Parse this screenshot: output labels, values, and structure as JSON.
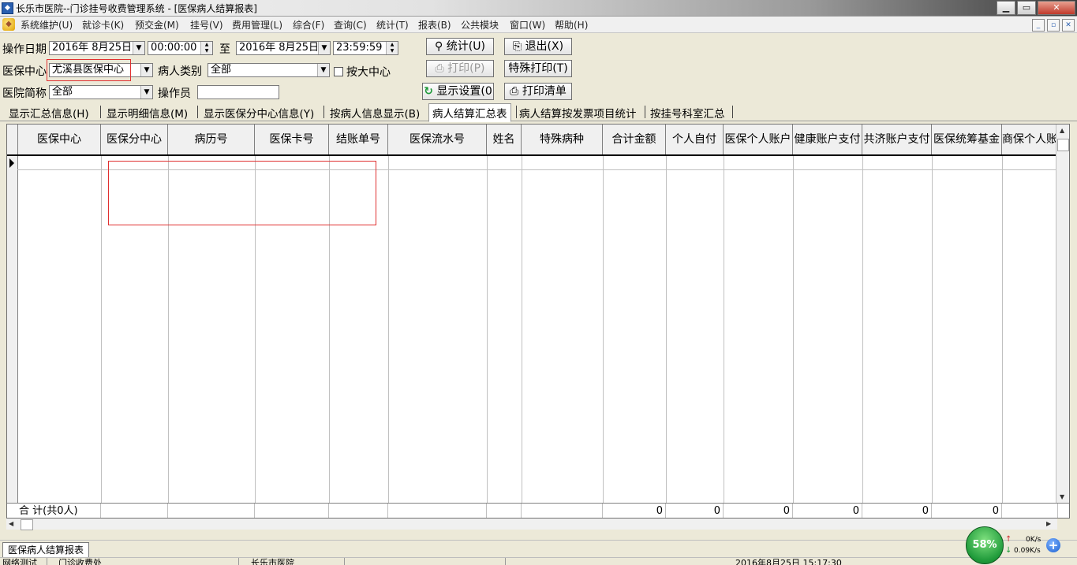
{
  "window": {
    "title": "长乐市医院--门诊挂号收费管理系统 - [医保病人结算报表]",
    "controls": {
      "minimize": "▁",
      "maximize": "▭",
      "close": "✕"
    }
  },
  "menubar": {
    "items": [
      "系统维护(U)",
      "就诊卡(K)",
      "预交金(M)",
      "挂号(V)",
      "费用管理(L)",
      "综合(F)",
      "查询(C)",
      "统计(T)",
      "报表(B)",
      "公共模块",
      "窗口(W)",
      "帮助(H)"
    ],
    "mdi_controls": {
      "minimize": "_",
      "restore": "▫",
      "close": "✕"
    }
  },
  "toolbar": {
    "op_date_label": "操作日期",
    "start_date": "2016年 8月25日",
    "start_time": "00:00:00",
    "to_label": "至",
    "end_date": "2016年 8月25日",
    "end_time": "23:59:59",
    "insurance_center_label": "医保中心",
    "insurance_center_value": "尤溪县医保中心",
    "patient_type_label": "病人类别",
    "patient_type_value": "全部",
    "by_major_center_label": "按大中心",
    "hospital_abbr_label": "医院简称",
    "hospital_abbr_value": "全部",
    "operator_label": "操作员",
    "operator_value": "",
    "buttons": {
      "stats": "统计(U)",
      "exit": "退出(X)",
      "print": "打印(P)",
      "special_print": "特殊打印(T)",
      "display_settings": "显示设置(0",
      "print_list": "打印清单"
    }
  },
  "tabs": [
    {
      "label": "显示汇总信息(H)",
      "active": false
    },
    {
      "label": "显示明细信息(M)",
      "active": false
    },
    {
      "label": "显示医保分中心信息(Y)",
      "active": false
    },
    {
      "label": "按病人信息显示(B)",
      "active": false
    },
    {
      "label": "病人结算汇总表",
      "active": true
    },
    {
      "label": "病人结算按发票项目统计",
      "active": false
    },
    {
      "label": "按挂号科室汇总",
      "active": false
    }
  ],
  "grid": {
    "columns": [
      "医保中心",
      "医保分中心",
      "病历号",
      "医保卡号",
      "结账单号",
      "医保流水号",
      "姓名",
      "特殊病种",
      "合计金额",
      "个人自付",
      "医保个人账户",
      "健康账户支付",
      "共济账户支付",
      "医保统筹基金",
      "商保个人账"
    ],
    "rows": [],
    "total_label": "合 计(共0人)",
    "totals": {
      "合计金额": "0",
      "个人自付": "0",
      "医保个人账户": "0",
      "健康账户支付": "0",
      "共济账户支付": "0",
      "医保统筹基金": "0"
    }
  },
  "bottom_tab": "医保病人结算报表",
  "statusbar": {
    "panels": [
      "网络测试",
      "门诊收费处",
      "长乐市医院",
      "2016年8月25日 15:17:30"
    ]
  },
  "system_tray": {
    "meter_percent": "58%",
    "up_speed": "0K/s",
    "down_speed": "0.09K/s"
  },
  "colors": {
    "highlight_border": "#e03030",
    "meter_green": "#1f9a3a"
  }
}
